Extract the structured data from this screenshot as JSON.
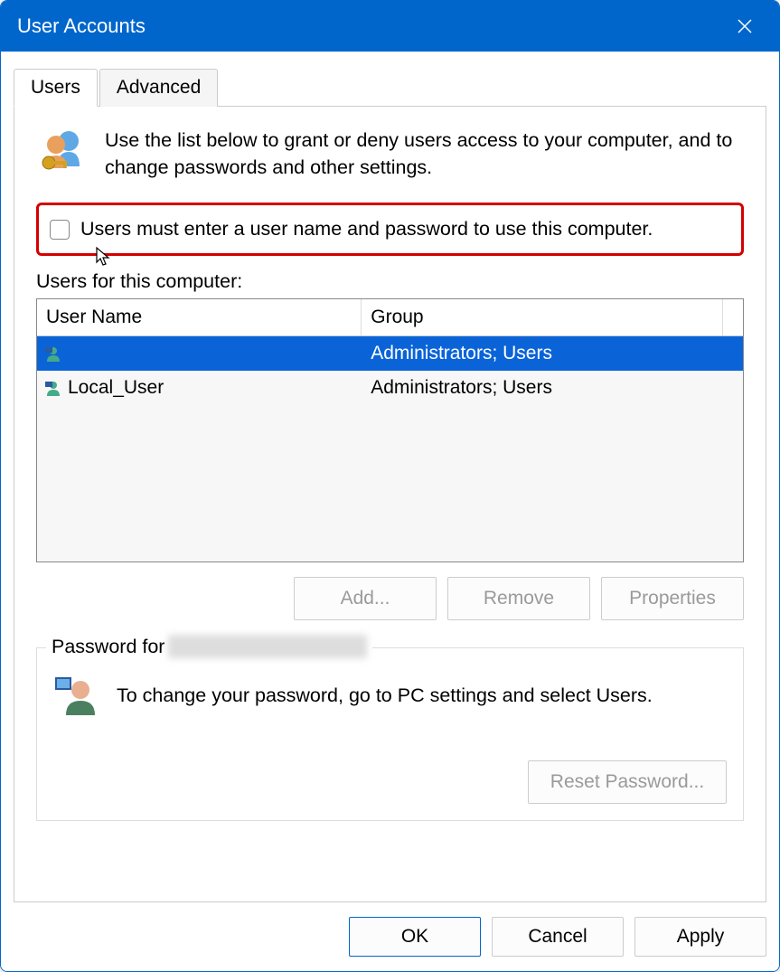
{
  "window": {
    "title": "User Accounts"
  },
  "tabs": {
    "users": "Users",
    "advanced": "Advanced"
  },
  "intro": "Use the list below to grant or deny users access to your computer, and to change passwords and other settings.",
  "checkbox": {
    "label": "Users must enter a user name and password to use this computer.",
    "checked": false
  },
  "list_label": "Users for this computer:",
  "columns": {
    "name": "User Name",
    "group": "Group"
  },
  "rows": [
    {
      "name": "",
      "group": "Administrators; Users",
      "selected": true
    },
    {
      "name": "Local_User",
      "group": "Administrators; Users",
      "selected": false
    }
  ],
  "buttons": {
    "add": "Add...",
    "remove": "Remove",
    "properties": "Properties"
  },
  "password_section": {
    "legend_prefix": "Password for",
    "text": "To change your password, go to PC settings and select Users.",
    "reset": "Reset Password..."
  },
  "footer": {
    "ok": "OK",
    "cancel": "Cancel",
    "apply": "Apply"
  }
}
